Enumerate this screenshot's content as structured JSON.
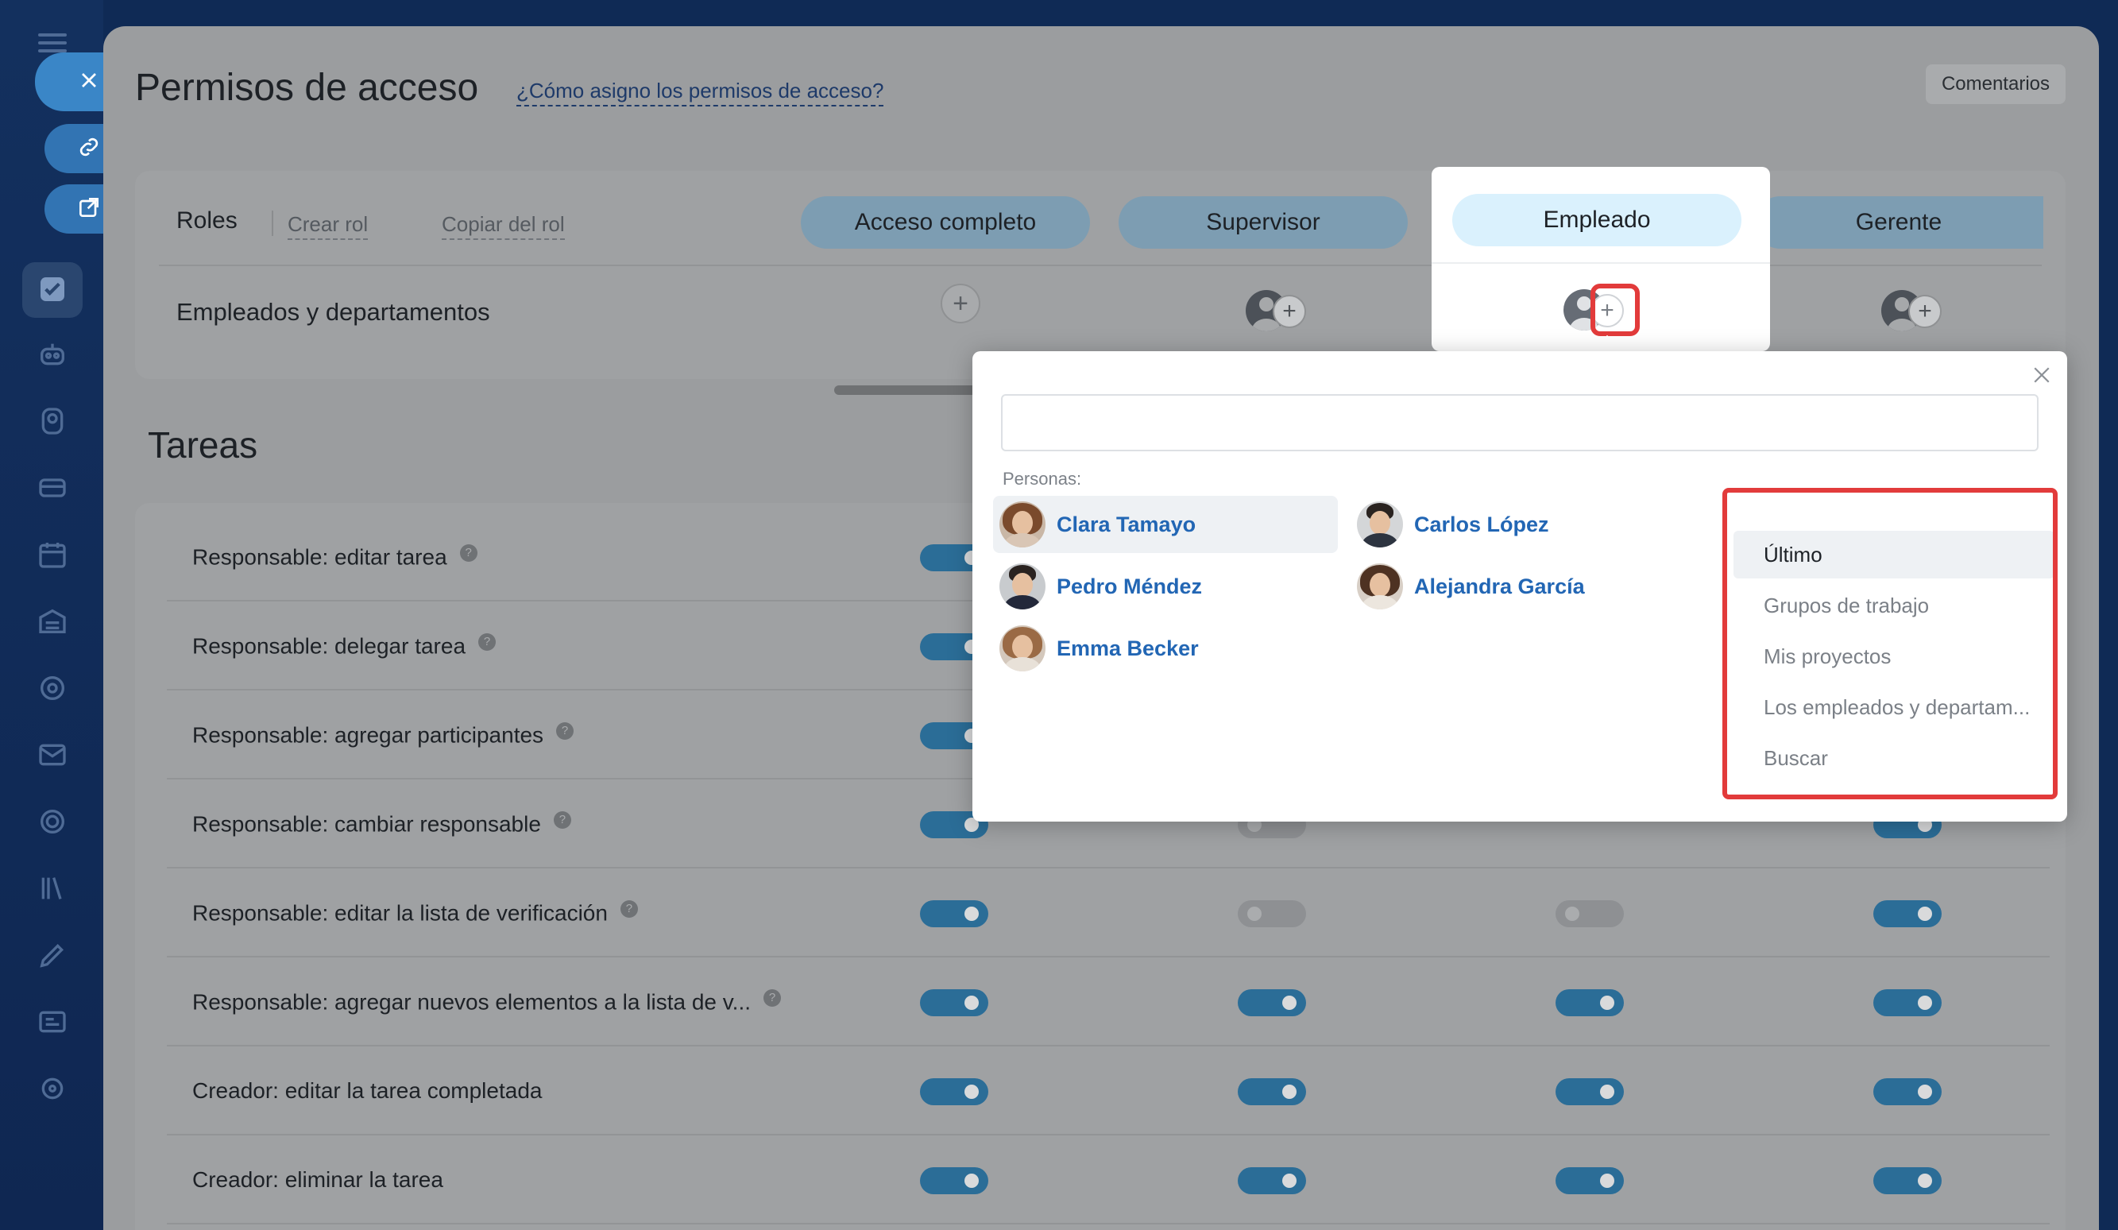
{
  "page": {
    "title": "Permisos de acceso",
    "help_link": "¿Cómo asigno los permisos de acceso?",
    "comments_button": "Comentarios"
  },
  "roles": {
    "label": "Roles",
    "create_role": "Crear rol",
    "copy_role": "Copiar del rol",
    "row_label": "Empleados y departamentos",
    "columns": [
      "Acceso completo",
      "Supervisor",
      "Empleado",
      "Gerente"
    ],
    "selected_column": "Empleado"
  },
  "tasks": {
    "title": "Tareas",
    "rows": [
      {
        "label": "Responsable: editar tarea",
        "help": true,
        "toggles": [
          "on",
          "hidden",
          "hidden",
          "hidden"
        ]
      },
      {
        "label": "Responsable: delegar tarea",
        "help": true,
        "toggles": [
          "on",
          "hidden",
          "hidden",
          "hidden"
        ]
      },
      {
        "label": "Responsable: agregar participantes",
        "help": true,
        "toggles": [
          "on",
          "hidden",
          "hidden",
          "hidden"
        ]
      },
      {
        "label": "Responsable: cambiar responsable",
        "help": true,
        "toggles": [
          "on",
          "off",
          "hidden",
          "on"
        ]
      },
      {
        "label": "Responsable: editar la lista de verificación",
        "help": true,
        "toggles": [
          "on",
          "off",
          "off",
          "on"
        ]
      },
      {
        "label": "Responsable: agregar nuevos elementos a la lista de v...",
        "help": true,
        "toggles": [
          "on",
          "on",
          "on",
          "on"
        ]
      },
      {
        "label": "Creador: editar la tarea completada",
        "help": false,
        "toggles": [
          "on",
          "on",
          "on",
          "on"
        ]
      },
      {
        "label": "Creador: eliminar la tarea",
        "help": false,
        "toggles": [
          "on",
          "on",
          "on",
          "on"
        ]
      }
    ]
  },
  "popup": {
    "search_placeholder": "",
    "people_label": "Personas:",
    "people": [
      {
        "name": "Clara Tamayo",
        "selected": true
      },
      {
        "name": "Carlos López",
        "selected": false
      },
      {
        "name": "Pedro Méndez",
        "selected": false
      },
      {
        "name": "Alejandra García",
        "selected": false
      },
      {
        "name": "Emma Becker",
        "selected": false
      }
    ],
    "menu": [
      {
        "label": "Último",
        "active": true
      },
      {
        "label": "Grupos de trabajo",
        "active": false
      },
      {
        "label": "Mis proyectos",
        "active": false
      },
      {
        "label": "Los empleados y departam...",
        "active": false
      },
      {
        "label": "Buscar",
        "active": false
      }
    ]
  },
  "icons": {
    "sidebar": [
      "menu-icon",
      "close-icon",
      "link-icon",
      "external-link-icon",
      "checkbox-icon",
      "robot-icon",
      "brain-icon",
      "card-icon",
      "calendar-icon",
      "warehouse-icon",
      "target-icon",
      "mail-icon",
      "circle-icon",
      "library-icon",
      "pencil-icon",
      "invoice-icon",
      "settings-icon"
    ]
  },
  "colors": {
    "accent": "#2266b4",
    "highlight_border": "#e23b3b",
    "toggle_on": "#2b6d97"
  }
}
